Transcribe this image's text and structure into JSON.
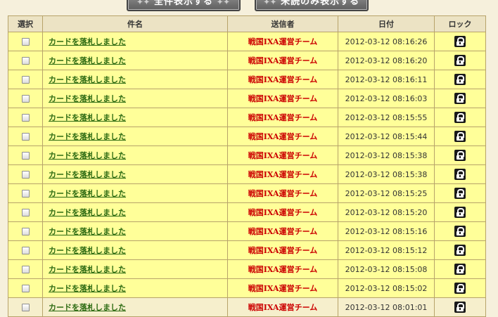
{
  "toolbar": {
    "show_all_label": "全件表示する",
    "show_unread_label": "未読のみ表示する"
  },
  "table": {
    "headers": {
      "select": "選択",
      "subject": "件名",
      "sender": "送信者",
      "date": "日付",
      "lock": "ロック"
    },
    "rows": [
      {
        "subject": "カードを落札しました",
        "sender": "戦国IXA運営チーム",
        "date": "2012-03-12 08:16:26",
        "read": false
      },
      {
        "subject": "カードを落札しました",
        "sender": "戦国IXA運営チーム",
        "date": "2012-03-12 08:16:20",
        "read": false
      },
      {
        "subject": "カードを落札しました",
        "sender": "戦国IXA運営チーム",
        "date": "2012-03-12 08:16:11",
        "read": false
      },
      {
        "subject": "カードを落札しました",
        "sender": "戦国IXA運営チーム",
        "date": "2012-03-12 08:16:03",
        "read": false
      },
      {
        "subject": "カードを落札しました",
        "sender": "戦国IXA運営チーム",
        "date": "2012-03-12 08:15:55",
        "read": false
      },
      {
        "subject": "カードを落札しました",
        "sender": "戦国IXA運営チーム",
        "date": "2012-03-12 08:15:44",
        "read": false
      },
      {
        "subject": "カードを落札しました",
        "sender": "戦国IXA運営チーム",
        "date": "2012-03-12 08:15:38",
        "read": false
      },
      {
        "subject": "カードを落札しました",
        "sender": "戦国IXA運営チーム",
        "date": "2012-03-12 08:15:38",
        "read": false
      },
      {
        "subject": "カードを落札しました",
        "sender": "戦国IXA運営チーム",
        "date": "2012-03-12 08:15:25",
        "read": false
      },
      {
        "subject": "カードを落札しました",
        "sender": "戦国IXA運営チーム",
        "date": "2012-03-12 08:15:20",
        "read": false
      },
      {
        "subject": "カードを落札しました",
        "sender": "戦国IXA運営チーム",
        "date": "2012-03-12 08:15:16",
        "read": false
      },
      {
        "subject": "カードを落札しました",
        "sender": "戦国IXA運営チーム",
        "date": "2012-03-12 08:15:12",
        "read": false
      },
      {
        "subject": "カードを落札しました",
        "sender": "戦国IXA運営チーム",
        "date": "2012-03-12 08:15:08",
        "read": false
      },
      {
        "subject": "カードを落札しました",
        "sender": "戦国IXA運営チーム",
        "date": "2012-03-12 08:15:02",
        "read": false
      },
      {
        "subject": "カードを落札しました",
        "sender": "戦国IXA運営チーム",
        "date": "2012-03-12 08:01:01",
        "read": true
      }
    ]
  },
  "colors": {
    "unread_row": "#ffff99",
    "read_row": "#f6efcc",
    "subject_link": "#2d6b12",
    "sender_text": "#cc0000",
    "border": "#b7a36a"
  },
  "icons": {
    "lock": "lock-icon",
    "checkbox": "checkbox"
  }
}
